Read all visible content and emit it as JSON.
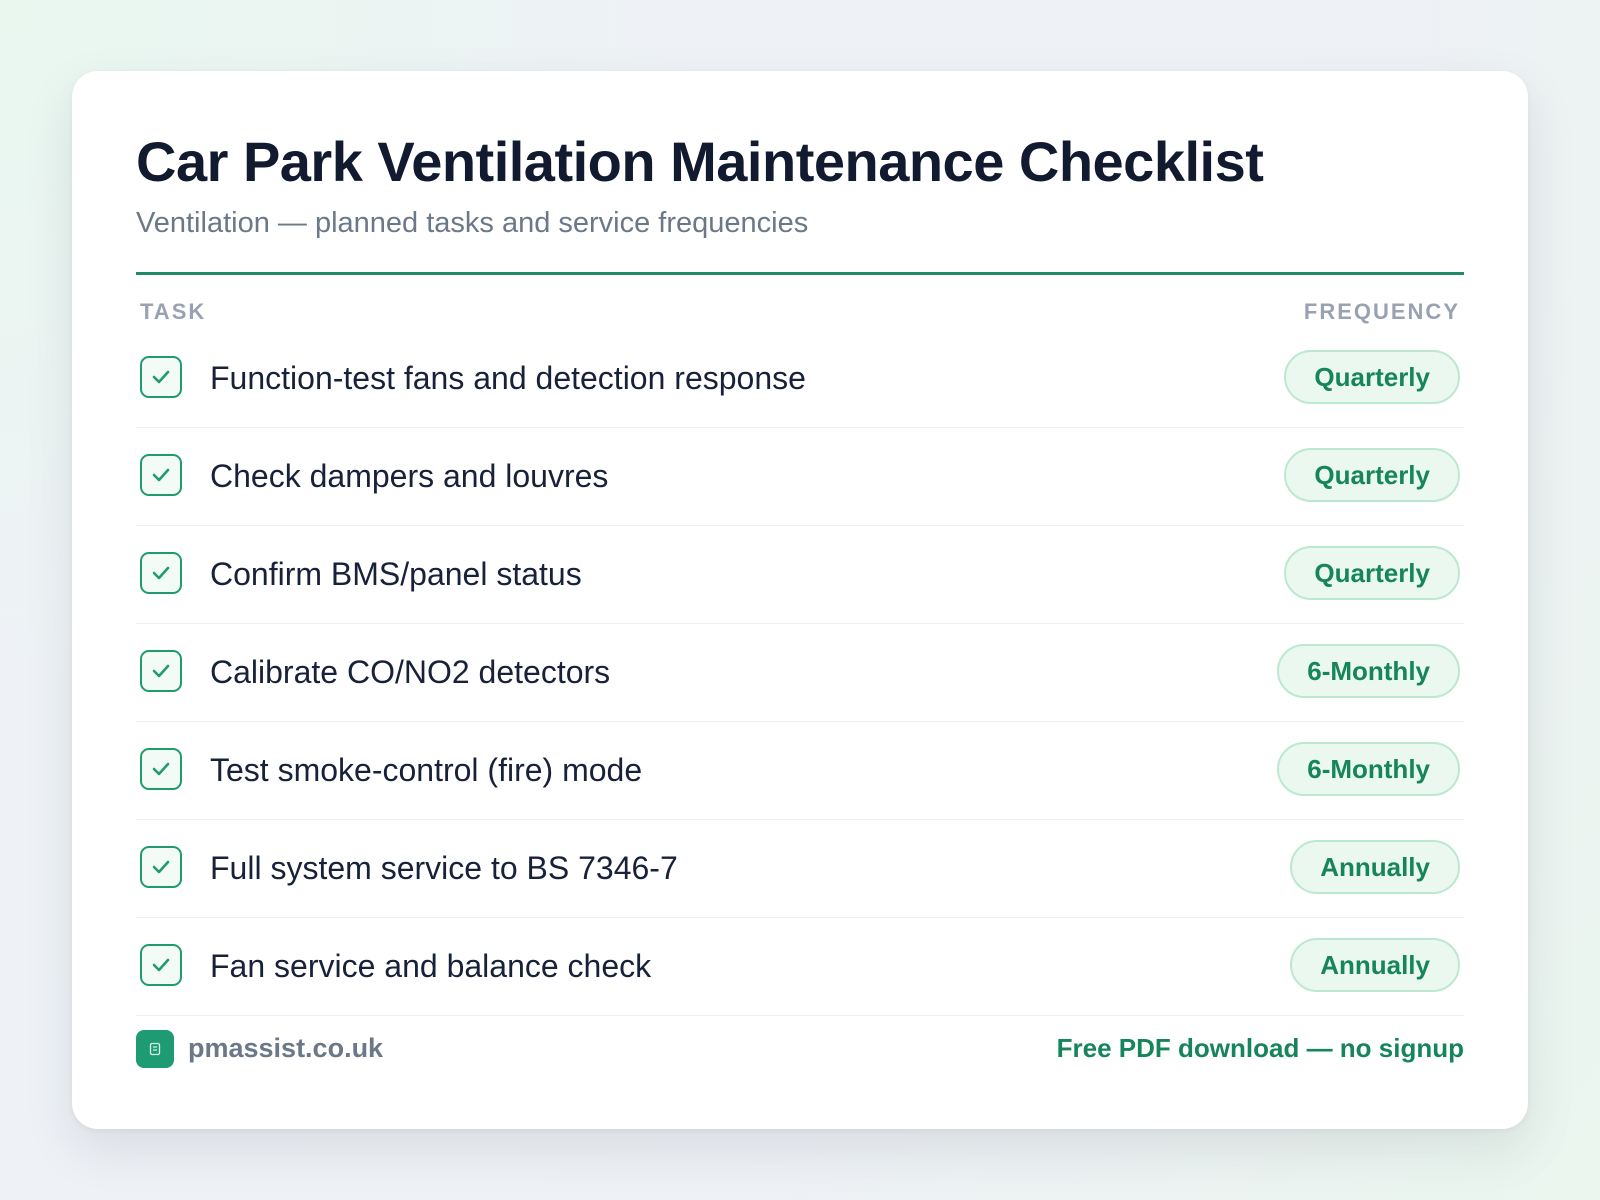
{
  "header": {
    "title": "Car Park Ventilation Maintenance Checklist",
    "subtitle": "Ventilation — planned tasks and service frequencies"
  },
  "columns": {
    "task": "TASK",
    "frequency": "FREQUENCY"
  },
  "tasks": [
    {
      "label": "Function-test fans and detection response",
      "frequency": "Quarterly",
      "checked": true
    },
    {
      "label": "Check dampers and louvres",
      "frequency": "Quarterly",
      "checked": true
    },
    {
      "label": "Confirm BMS/panel status",
      "frequency": "Quarterly",
      "checked": true
    },
    {
      "label": "Calibrate CO/NO2 detectors",
      "frequency": "6-Monthly",
      "checked": true
    },
    {
      "label": "Test smoke-control (fire) mode",
      "frequency": "6-Monthly",
      "checked": true
    },
    {
      "label": "Full system service to BS 7346-7",
      "frequency": "Annually",
      "checked": true
    },
    {
      "label": "Fan service and balance check",
      "frequency": "Annually",
      "checked": true
    }
  ],
  "footer": {
    "site": "pmassist.co.uk",
    "logo_icon": "building-icon",
    "cta": "Free PDF download — no signup"
  },
  "colors": {
    "accent": "#1f8a63",
    "pill_bg": "#eaf8f0",
    "pill_text": "#17855b",
    "title": "#111a2e"
  }
}
